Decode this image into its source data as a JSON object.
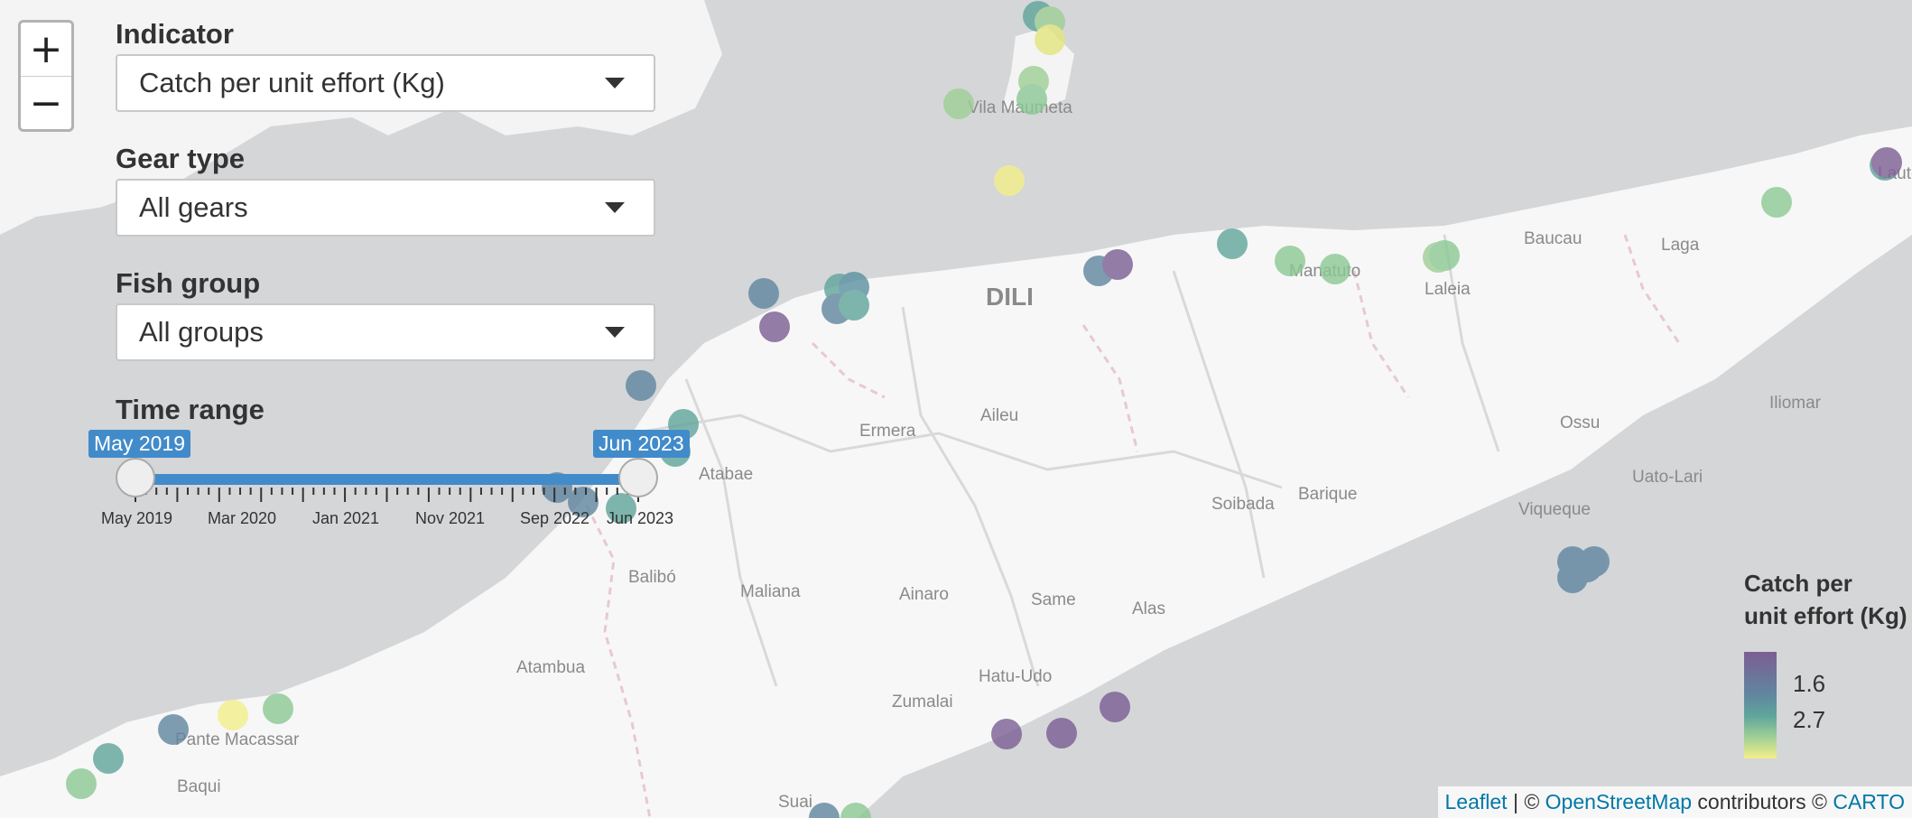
{
  "controls": {
    "zoom_in": "+",
    "zoom_out": "−",
    "indicator": {
      "label": "Indicator",
      "value": "Catch per unit effort (Kg)"
    },
    "gear": {
      "label": "Gear type",
      "value": "All gears"
    },
    "fish": {
      "label": "Fish group",
      "value": "All groups"
    },
    "time": {
      "label": "Time range",
      "start": "May 2019",
      "end": "Jun 2023",
      "ticks": [
        "May 2019",
        "Mar 2020",
        "Jan 2021",
        "Nov 2021",
        "Sep 2022",
        "Jun 2023"
      ]
    }
  },
  "legend": {
    "title_line1": "Catch per",
    "title_line2": "unit effort (Kg)",
    "val1": "1.6",
    "val2": "2.7"
  },
  "attribution": {
    "leaflet": "Leaflet",
    "sep": " | © ",
    "osm": "OpenStreetMap",
    "contrib": " contributors © ",
    "carto": "CARTO"
  },
  "places": {
    "dili": "DILI",
    "vila_maumeta": "Vila Maumeta",
    "manatuto": "Manatuto",
    "laleia": "Laleia",
    "baucau": "Baucau",
    "laga": "Laga",
    "lautem": "Lautém",
    "iliomar": "Iliomar",
    "ossu": "Ossu",
    "uato_lari": "Uato-Lari",
    "viqueque": "Viqueque",
    "barique": "Barique",
    "soibada": "Soibada",
    "aileu": "Aileu",
    "ermera": "Ermera",
    "atabae": "Atabae",
    "balibo": "Balibó",
    "maliana": "Maliana",
    "ainaro": "Ainaro",
    "same": "Same",
    "alas": "Alas",
    "hatu_udo": "Hatu-Udo",
    "zumalai": "Zumalai",
    "atambua": "Atambua",
    "pante_macassar": "Pante Macassar",
    "baqui": "Baqui",
    "suai": "Suai"
  }
}
